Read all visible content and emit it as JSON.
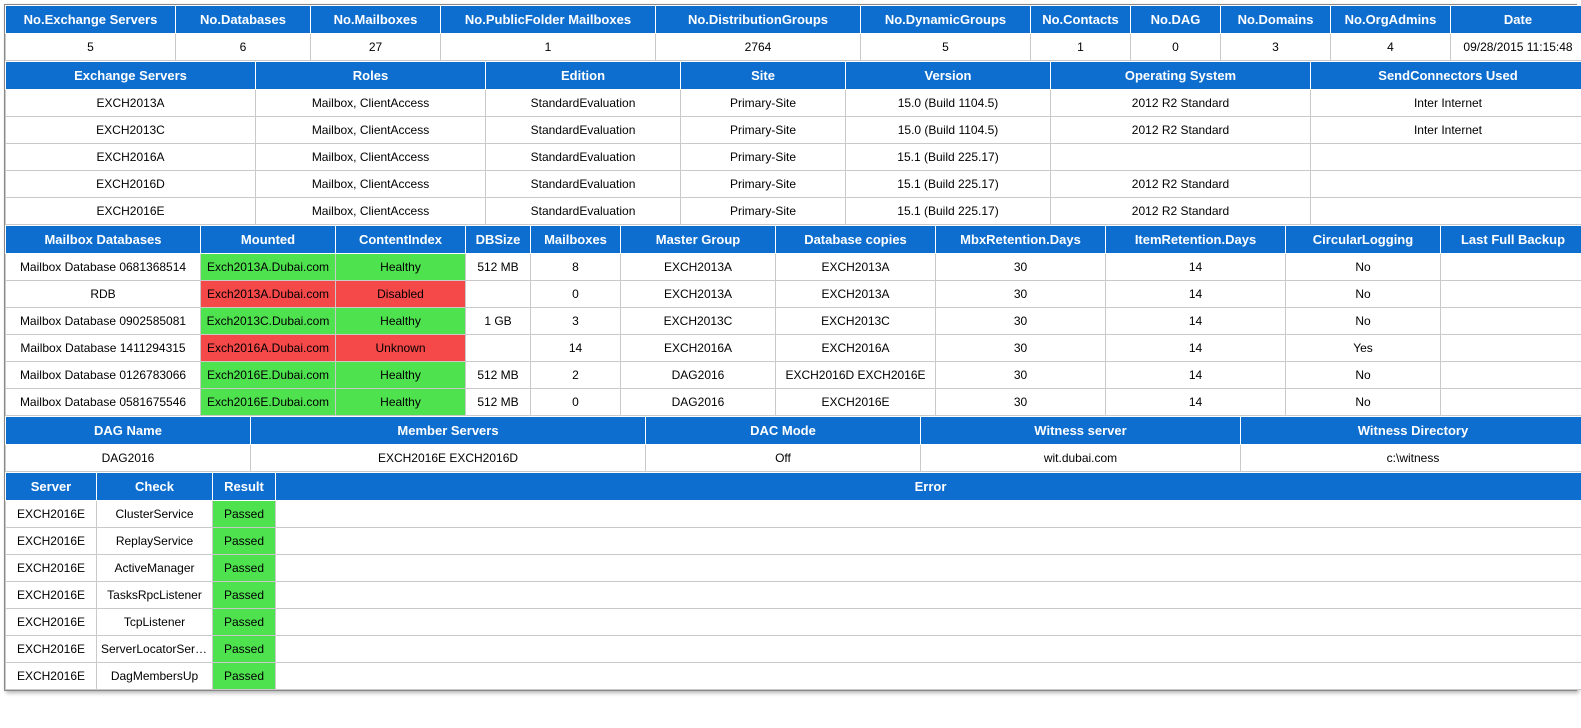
{
  "summary": {
    "headers": [
      "No.Exchange Servers",
      "No.Databases",
      "No.Mailboxes",
      "No.PublicFolder Mailboxes",
      "No.DistributionGroups",
      "No.DynamicGroups",
      "No.Contacts",
      "No.DAG",
      "No.Domains",
      "No.OrgAdmins",
      "Date"
    ],
    "values": [
      "5",
      "6",
      "27",
      "1",
      "2764",
      "5",
      "1",
      "0",
      "3",
      "4",
      "09/28/2015 11:15:48"
    ]
  },
  "servers": {
    "headers": [
      "Exchange Servers",
      "Roles",
      "Edition",
      "Site",
      "Version",
      "Operating System",
      "SendConnectors Used"
    ],
    "rows": [
      [
        "EXCH2013A",
        "Mailbox, ClientAccess",
        "StandardEvaluation",
        "Primary-Site",
        "15.0 (Build 1104.5)",
        "2012 R2 Standard",
        "Inter Internet"
      ],
      [
        "EXCH2013C",
        "Mailbox, ClientAccess",
        "StandardEvaluation",
        "Primary-Site",
        "15.0 (Build 1104.5)",
        "2012 R2 Standard",
        "Inter Internet"
      ],
      [
        "EXCH2016A",
        "Mailbox, ClientAccess",
        "StandardEvaluation",
        "Primary-Site",
        "15.1 (Build 225.17)",
        "",
        ""
      ],
      [
        "EXCH2016D",
        "Mailbox, ClientAccess",
        "StandardEvaluation",
        "Primary-Site",
        "15.1 (Build 225.17)",
        "2012 R2 Standard",
        ""
      ],
      [
        "EXCH2016E",
        "Mailbox, ClientAccess",
        "StandardEvaluation",
        "Primary-Site",
        "15.1 (Build 225.17)",
        "2012 R2 Standard",
        ""
      ]
    ]
  },
  "databases": {
    "headers": [
      "Mailbox Databases",
      "Mounted",
      "ContentIndex",
      "DBSize",
      "Mailboxes",
      "Master Group",
      "Database copies",
      "MbxRetention.Days",
      "ItemRetention.Days",
      "CircularLogging",
      "Last Full Backup"
    ],
    "rows": [
      {
        "c": [
          "Mailbox Database 0681368514",
          "Exch2013A.Dubai.com",
          "Healthy",
          "512 MB",
          "8",
          "EXCH2013A",
          "EXCH2013A",
          "30",
          "14",
          "No",
          ""
        ],
        "s": [
          "",
          "green",
          "green",
          "",
          "",
          "",
          "",
          "",
          "",
          "",
          ""
        ]
      },
      {
        "c": [
          "RDB",
          "Exch2013A.Dubai.com",
          "Disabled",
          "",
          "0",
          "EXCH2013A",
          "EXCH2013A",
          "30",
          "14",
          "No",
          ""
        ],
        "s": [
          "",
          "red",
          "red",
          "",
          "",
          "",
          "",
          "",
          "",
          "",
          ""
        ]
      },
      {
        "c": [
          "Mailbox Database 0902585081",
          "Exch2013C.Dubai.com",
          "Healthy",
          "1 GB",
          "3",
          "EXCH2013C",
          "EXCH2013C",
          "30",
          "14",
          "No",
          ""
        ],
        "s": [
          "",
          "green",
          "green",
          "",
          "",
          "",
          "",
          "",
          "",
          "",
          ""
        ]
      },
      {
        "c": [
          "Mailbox Database 1411294315",
          "Exch2016A.Dubai.com",
          "Unknown",
          "",
          "14",
          "EXCH2016A",
          "EXCH2016A",
          "30",
          "14",
          "Yes",
          ""
        ],
        "s": [
          "",
          "red",
          "red",
          "",
          "",
          "",
          "",
          "",
          "",
          "",
          ""
        ]
      },
      {
        "c": [
          "Mailbox Database 0126783066",
          "Exch2016E.Dubai.com",
          "Healthy",
          "512 MB",
          "2",
          "DAG2016",
          "EXCH2016D EXCH2016E",
          "30",
          "14",
          "No",
          ""
        ],
        "s": [
          "",
          "green",
          "green",
          "",
          "",
          "",
          "",
          "",
          "",
          "",
          ""
        ]
      },
      {
        "c": [
          "Mailbox Database 0581675546",
          "Exch2016E.Dubai.com",
          "Healthy",
          "512 MB",
          "0",
          "DAG2016",
          "EXCH2016E",
          "30",
          "14",
          "No",
          ""
        ],
        "s": [
          "",
          "green",
          "green",
          "",
          "",
          "",
          "",
          "",
          "",
          "",
          ""
        ]
      }
    ]
  },
  "dag": {
    "headers": [
      "DAG Name",
      "Member Servers",
      "DAC Mode",
      "Witness server",
      "Witness Directory"
    ],
    "values": [
      "DAG2016",
      "EXCH2016E EXCH2016D",
      "Off",
      "wit.dubai.com",
      "c:\\witness"
    ]
  },
  "checks": {
    "headers": [
      "Server",
      "Check",
      "Result",
      "Error"
    ],
    "rows": [
      {
        "c": [
          "EXCH2016E",
          "ClusterService",
          "Passed",
          ""
        ],
        "s": [
          "",
          "",
          "green",
          ""
        ]
      },
      {
        "c": [
          "EXCH2016E",
          "ReplayService",
          "Passed",
          ""
        ],
        "s": [
          "",
          "",
          "green",
          ""
        ]
      },
      {
        "c": [
          "EXCH2016E",
          "ActiveManager",
          "Passed",
          ""
        ],
        "s": [
          "",
          "",
          "green",
          ""
        ]
      },
      {
        "c": [
          "EXCH2016E",
          "TasksRpcListener",
          "Passed",
          ""
        ],
        "s": [
          "",
          "",
          "green",
          ""
        ]
      },
      {
        "c": [
          "EXCH2016E",
          "TcpListener",
          "Passed",
          ""
        ],
        "s": [
          "",
          "",
          "green",
          ""
        ]
      },
      {
        "c": [
          "EXCH2016E",
          "ServerLocatorService",
          "Passed",
          ""
        ],
        "s": [
          "",
          "",
          "green",
          ""
        ]
      },
      {
        "c": [
          "EXCH2016E",
          "DagMembersUp",
          "Passed",
          ""
        ],
        "s": [
          "",
          "",
          "green",
          ""
        ]
      }
    ]
  },
  "colWidths": {
    "summary": [
      170,
      135,
      130,
      215,
      205,
      170,
      100,
      90,
      110,
      120,
      135
    ],
    "servers": [
      250,
      230,
      195,
      165,
      205,
      260,
      275
    ],
    "databases": [
      195,
      135,
      130,
      65,
      90,
      155,
      160,
      170,
      180,
      155,
      145
    ],
    "dag": [
      245,
      395,
      275,
      320,
      345
    ],
    "checks": [
      91,
      116,
      63,
      1310
    ]
  }
}
